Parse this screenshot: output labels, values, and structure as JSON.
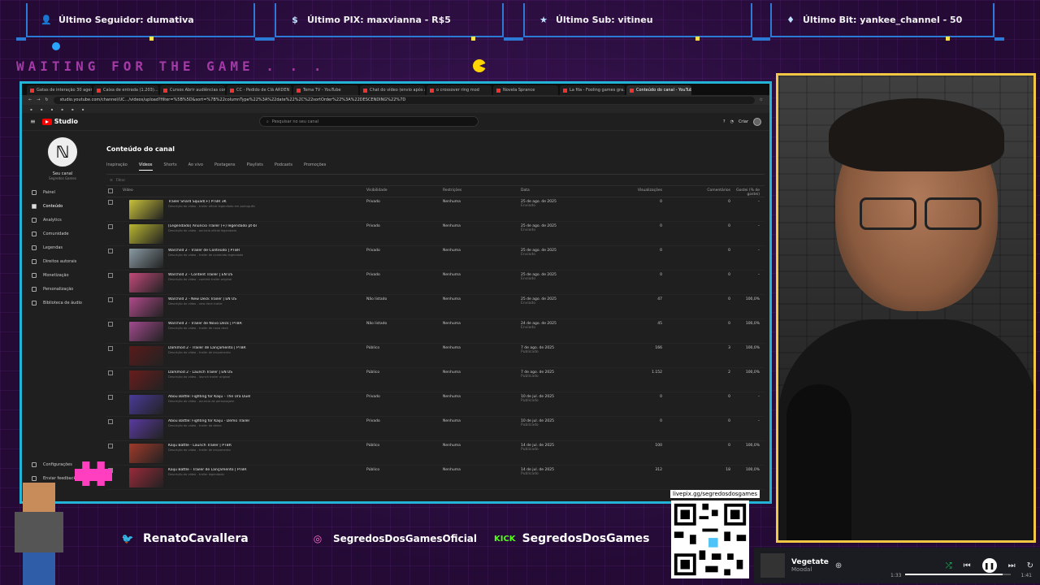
{
  "topbars": [
    {
      "icon": "user-icon",
      "text": "Último Seguidor: dumativa"
    },
    {
      "icon": "dollar-icon",
      "text": "Último PIX: maxvianna - R$5"
    },
    {
      "icon": "star-icon",
      "text": "Último Sub: vitineu"
    },
    {
      "icon": "diamond-icon",
      "text": "Último Bit: yankee_channel - 50"
    }
  ],
  "waiting_text": "WAITING FOR THE GAME . . .",
  "browser": {
    "url": "studio.youtube.com/channel/UC.../videos/upload?filter=%5B%5D&sort=%7B%22columnType%22%3A%22date%22%2C%22sortOrder%22%3A%22DESCENDING%22%7D",
    "tabs": [
      "Gatas de interação 30 agendam...",
      "Caixa de entrada (1.203)...",
      "Cursos Abrir audiências com...",
      "CC - Pedido de Clã ARDEN",
      "Tema TV - YouTube",
      "Chat do vídeo (envio após at...",
      "o crossover ring mod",
      "Novela Sprance",
      "La fila - Fooling games gra...",
      "Conteúdo do canal - YouTube"
    ],
    "search_placeholder": "Pesquisar no seu canal",
    "create_label": "Criar"
  },
  "studio": {
    "logo": "Studio",
    "channel_name": "Seu canal",
    "channel_sub": "Segredos Games",
    "nav": [
      {
        "icon": "dashboard-icon",
        "label": "Painel"
      },
      {
        "icon": "content-icon",
        "label": "Conteúdo"
      },
      {
        "icon": "analytics-icon",
        "label": "Analytics"
      },
      {
        "icon": "community-icon",
        "label": "Comunidade"
      },
      {
        "icon": "subtitles-icon",
        "label": "Legendas"
      },
      {
        "icon": "copyright-icon",
        "label": "Direitos autorais"
      },
      {
        "icon": "monetization-icon",
        "label": "Monetização"
      },
      {
        "icon": "customization-icon",
        "label": "Personalização"
      },
      {
        "icon": "audio-library-icon",
        "label": "Biblioteca de áudio"
      }
    ],
    "nav_bottom": [
      "Configurações",
      "Enviar feedback"
    ],
    "page_title": "Conteúdo do canal",
    "tabs": [
      "Inspiração",
      "Vídeos",
      "Shorts",
      "Ao vivo",
      "Postagens",
      "Playlists",
      "Podcasts",
      "Promoções"
    ],
    "filter": "Filtrar",
    "columns": [
      "Vídeo",
      "Visibilidade",
      "Restrições",
      "Data",
      "Visualizações",
      "Comentários",
      "Gostei (% de gostei)"
    ],
    "rows": [
      {
        "title": "Trailer Shard Squad(+) PTBR 3K",
        "desc": "Descrição do vídeo - trailer oficial legendado em português",
        "visibility": "Privado",
        "restrictions": "Nenhuma",
        "date": "25 de ago. de 2025",
        "date_sub": "Enviado",
        "views": "0",
        "comments": "0",
        "likes": "–",
        "thumb": "#c9c23a"
      },
      {
        "title": "[Legendado] Anúncio Trailer (+) legendado pt-br",
        "desc": "Descrição do vídeo - anúncio oficial legendado",
        "visibility": "Privado",
        "restrictions": "Nenhuma",
        "date": "25 de ago. de 2025",
        "date_sub": "Enviado",
        "views": "0",
        "comments": "0",
        "likes": "–",
        "thumb": "#b8b530"
      },
      {
        "title": "Warchild 2 - Trailer de Conteúdo | PTBR",
        "desc": "Descrição do vídeo - trailer de conteúdo legendado",
        "visibility": "Privado",
        "restrictions": "Nenhuma",
        "date": "25 de ago. de 2025",
        "date_sub": "Enviado",
        "views": "0",
        "comments": "0",
        "likes": "–",
        "thumb": "#8a9aa3"
      },
      {
        "title": "Warchild 2 - Content Trailer | EN US",
        "desc": "Descrição do vídeo - content trailer original",
        "visibility": "Privado",
        "restrictions": "Nenhuma",
        "date": "25 de ago. de 2025",
        "date_sub": "Enviado",
        "views": "0",
        "comments": "0",
        "likes": "–",
        "thumb": "#c24a7a"
      },
      {
        "title": "Warchild 2 - New Deck Trailer | EN US",
        "desc": "Descrição do vídeo - new deck trailer",
        "visibility": "Não listado",
        "restrictions": "Nenhuma",
        "date": "25 de ago. de 2025",
        "date_sub": "Enviado",
        "views": "47",
        "comments": "0",
        "likes": "100,0%",
        "thumb": "#b04a8a"
      },
      {
        "title": "Warchild 2 - Trailer de Novo Deck | PTBR",
        "desc": "Descrição do vídeo - trailer de novo deck",
        "visibility": "Não listado",
        "restrictions": "Nenhuma",
        "date": "24 de ago. de 2025",
        "date_sub": "Enviado",
        "views": "45",
        "comments": "0",
        "likes": "100,0%",
        "thumb": "#a24a8e"
      },
      {
        "title": "Darkmod 2 - Trailer de Lançamento | PTBR",
        "desc": "Descrição do vídeo - trailer de lançamento",
        "visibility": "Público",
        "restrictions": "Nenhuma",
        "date": "7 de ago. de 2025",
        "date_sub": "Publicado",
        "views": "166",
        "comments": "3",
        "likes": "100,0%",
        "thumb": "#5a1a1a"
      },
      {
        "title": "Darkmod 2 - Launch Trailer | EN US",
        "desc": "Descrição do vídeo - launch trailer original",
        "visibility": "Público",
        "restrictions": "Nenhuma",
        "date": "7 de ago. de 2025",
        "date_sub": "Publicado",
        "views": "1.152",
        "comments": "2",
        "likes": "100,0%",
        "thumb": "#6a1c1c"
      },
      {
        "title": "Abou Battle: Fighting for Kaiju - The Ura Duel",
        "desc": "Descrição do vídeo - anúncio de personagem",
        "visibility": "Privado",
        "restrictions": "Nenhuma",
        "date": "10 de jul. de 2025",
        "date_sub": "Publicado",
        "views": "0",
        "comments": "0",
        "likes": "–",
        "thumb": "#4a3a9a"
      },
      {
        "title": "Abou Battle: Fighting for Kaiju - Demo Trailer",
        "desc": "Descrição do vídeo - trailer da demo",
        "visibility": "Privado",
        "restrictions": "Nenhuma",
        "date": "10 de jul. de 2025",
        "date_sub": "Publicado",
        "views": "0",
        "comments": "0",
        "likes": "–",
        "thumb": "#5a3aa0"
      },
      {
        "title": "Kaiju Battle - Launch Trailer | PTBR",
        "desc": "Descrição do vídeo - trailer de lançamento",
        "visibility": "Público",
        "restrictions": "Nenhuma",
        "date": "14 de jul. de 2025",
        "date_sub": "Publicado",
        "views": "100",
        "comments": "0",
        "likes": "100,0%",
        "thumb": "#a03a2a"
      },
      {
        "title": "Kaiju Battle - Trailer de Lançamento | PTBR",
        "desc": "Descrição do vídeo - trailer legendado",
        "visibility": "Público",
        "restrictions": "Nenhuma",
        "date": "14 de jul. de 2025",
        "date_sub": "Publicado",
        "views": "312",
        "comments": "18",
        "likes": "100,0%",
        "thumb": "#9a2a3a"
      }
    ]
  },
  "socials": [
    {
      "icon": "twitter-icon",
      "name": "RenatoCavallera"
    },
    {
      "icon": "instagram-icon",
      "name": "SegredosDosGamesOficial"
    },
    {
      "icon": "kick-icon",
      "name": "SegredosDosGames",
      "badge": "KICK"
    }
  ],
  "qr_label": "livepix.gg/segredosdosgames",
  "music": {
    "title": "Vegetate",
    "artist": "Moodal",
    "elapsed": "1:33",
    "total": "1:41",
    "progress": 0.92
  }
}
